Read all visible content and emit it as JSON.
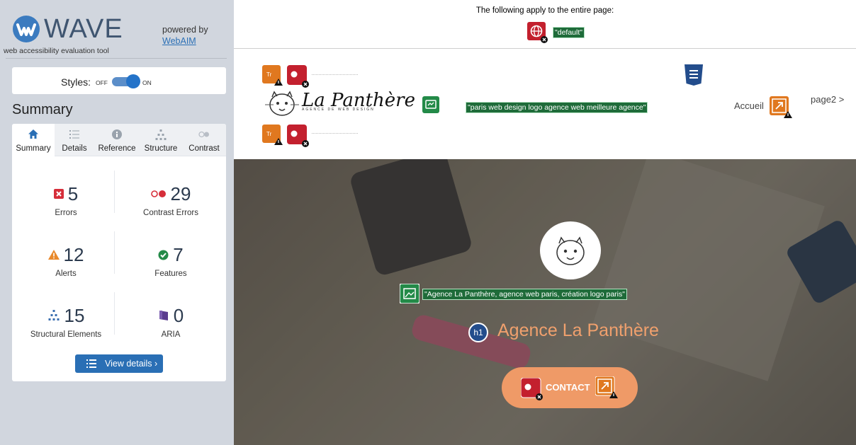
{
  "sidebar": {
    "logo_text": "WAVE",
    "tagline": "web accessibility evaluation tool",
    "powered_by": "powered by",
    "powered_link": "WebAIM",
    "styles": {
      "label": "Styles:",
      "off": "OFF",
      "on": "ON",
      "state": "on"
    },
    "summary_heading": "Summary",
    "tabs": [
      {
        "label": "Summary",
        "icon": "home-icon",
        "active": true
      },
      {
        "label": "Details",
        "icon": "list-icon",
        "active": false
      },
      {
        "label": "Reference",
        "icon": "info-icon",
        "active": false
      },
      {
        "label": "Structure",
        "icon": "hierarchy-icon",
        "active": false
      },
      {
        "label": "Contrast",
        "icon": "contrast-icon",
        "active": false
      }
    ],
    "stats": {
      "errors": {
        "value": "5",
        "label": "Errors",
        "icon": "error-icon",
        "color": "#d62e3a"
      },
      "contrast_errors": {
        "value": "29",
        "label": "Contrast Errors",
        "icon": "contrast-error-icon",
        "color": "#d62e3a"
      },
      "alerts": {
        "value": "12",
        "label": "Alerts",
        "icon": "alert-icon",
        "color": "#e9892b"
      },
      "features": {
        "value": "7",
        "label": "Features",
        "icon": "feature-icon",
        "color": "#238a48"
      },
      "structural": {
        "value": "15",
        "label": "Structural Elements",
        "icon": "structure-icon",
        "color": "#3b6fb0"
      },
      "aria": {
        "value": "0",
        "label": "ARIA",
        "icon": "aria-icon",
        "color": "#5a3c8e"
      }
    },
    "view_details": "View details ›"
  },
  "page": {
    "apply_text": "The following apply to the entire page:",
    "lang_tag": "\"default\"",
    "logo_alt_tag": "\"paris web design logo agence web meilleure agence\"",
    "brand_name": "La Panthère",
    "brand_sub": "AGENCE DE WEB DESIGN",
    "nav": {
      "accueil": "Accueil",
      "page2": "page2 >"
    },
    "hero_alt_tag": "\"Agence La Panthère, agence web paris, création logo paris\"",
    "hero_title": "Agence La Panthère",
    "h1_badge": "h1",
    "contact": "CONTACT"
  }
}
